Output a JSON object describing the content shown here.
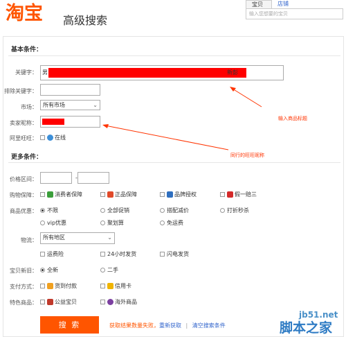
{
  "header": {
    "logo": "淘宝",
    "subtitle": "高级搜索",
    "tabs": [
      "宝贝",
      "店铺"
    ],
    "search_placeholder": "输入您想要的宝贝"
  },
  "basic": {
    "title": "基本条件：",
    "keyword_label": "关键字：",
    "keyword_prefix": "男",
    "keyword_suffix": "新彭",
    "exclude_label": "排除关键字：",
    "market_label": "市场：",
    "market_value": "所有市场",
    "seller_label": "卖家昵称：",
    "wangwang_label": "阿里旺旺：",
    "wangwang_option": "在线"
  },
  "annotations": {
    "title_hint": "输入商品标题",
    "seller_hint": "同行的旺旺昵称"
  },
  "more": {
    "title": "更多条件：",
    "price_label": "价格区间：",
    "price_sep": "-",
    "guarantee_label": "购物保障：",
    "guarantee_options": [
      "消费者保障",
      "正品保障",
      "品牌授权",
      "假一赔三"
    ],
    "promo_label": "商品优惠：",
    "promo_options_row1": [
      "不限",
      "全部促销",
      "搭配减价",
      "打折秒杀"
    ],
    "promo_options_row2": [
      "vip优惠",
      "聚划算",
      "免运费"
    ],
    "logistics_label": "物流：",
    "logistics_value": "所有地区",
    "logistics_options": [
      "运费险",
      "24小时发货",
      "闪电发货"
    ],
    "condition_label": "宝贝新旧：",
    "condition_options": [
      "全新",
      "二手"
    ],
    "payment_label": "支付方式：",
    "payment_options": [
      "货到付款",
      "信用卡"
    ],
    "special_label": "特色商品：",
    "special_options": [
      "公益宝贝",
      "海外商品"
    ]
  },
  "footer": {
    "search_button": "搜 索",
    "status_text": "获取结果数量失败，",
    "retry_link": "重新获取",
    "separator": "|",
    "clear_link": "清空搜索条件"
  },
  "watermark": {
    "line1": "jb51.net",
    "line2": "脚本之家"
  },
  "colors": {
    "brand": "#ff5500",
    "annotation": "#ff3300",
    "link": "#3366cc"
  }
}
